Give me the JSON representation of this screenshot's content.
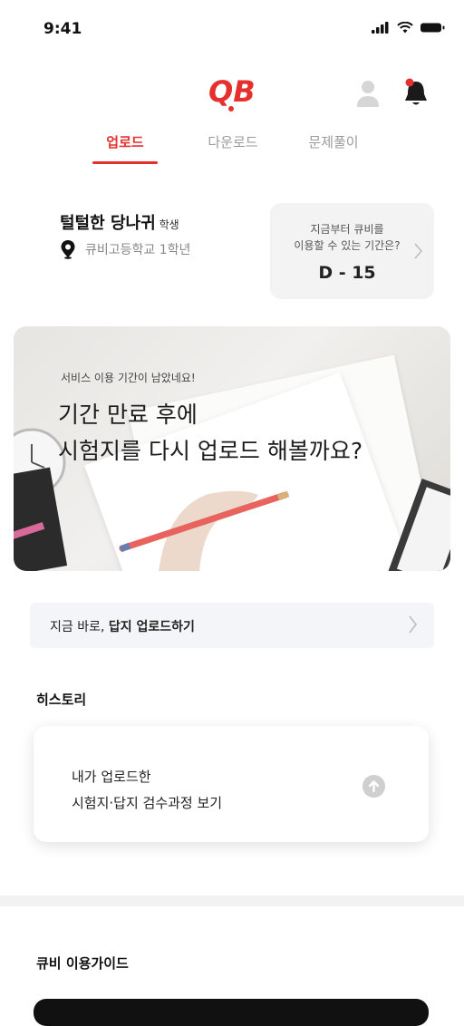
{
  "status_bar": {
    "time": "9:41"
  },
  "header": {
    "logo_text": "QB"
  },
  "tabs": [
    {
      "label": "업로드"
    },
    {
      "label": "다운로드"
    },
    {
      "label": "문제풀이"
    }
  ],
  "user": {
    "name": "털털한 당나귀",
    "role": "학생",
    "school": "큐비고등학교 1학년"
  },
  "dday": {
    "line1": "지금부터 큐비를",
    "line2": "이용할 수 있는 기간은?",
    "value": "D - 15"
  },
  "banner": {
    "subtitle": "서비스 이용 기간이 남았네요!",
    "title_line1": "기간 만료 후에",
    "title_line2": "시험지를 다시 업로드 해볼까요?"
  },
  "upload_bar": {
    "prefix": "지금 바로, ",
    "bold": "답지 업로드하기"
  },
  "history": {
    "label": "히스토리",
    "line1": "내가 업로드한",
    "line2": "시험지·답지 검수과정 보기"
  },
  "guide": {
    "label": "큐비 이용가이드"
  },
  "colors": {
    "accent": "#e5302d"
  }
}
